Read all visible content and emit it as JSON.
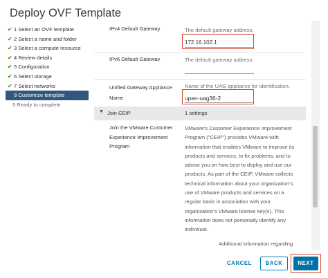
{
  "dialog": {
    "title": "Deploy OVF Template"
  },
  "steps": [
    {
      "label": "1 Select an OVF template",
      "state": "done"
    },
    {
      "label": "2 Select a name and folder",
      "state": "done"
    },
    {
      "label": "3 Select a compute resource",
      "state": "done"
    },
    {
      "label": "4 Review details",
      "state": "done"
    },
    {
      "label": "5 Configuration",
      "state": "done"
    },
    {
      "label": "6 Select storage",
      "state": "done"
    },
    {
      "label": "7 Select networks",
      "state": "done"
    },
    {
      "label": "8 Customize template",
      "state": "active"
    },
    {
      "label": "9 Ready to complete",
      "state": "pending"
    }
  ],
  "fields": {
    "ipv4": {
      "label": "IPv4 Default Gateway",
      "description": "The default gateway address.",
      "value": "172.16.102.1"
    },
    "ipv6": {
      "label": "IPv6 Default Gateway",
      "description": "The default gateway address.",
      "value": ""
    },
    "uag_name": {
      "label_line1": "Unified Gateway Appliance",
      "label_line2": "Name",
      "description": "Name of the UAG appliance for identification.",
      "value": "upen-uag36-2"
    }
  },
  "ceip_section": {
    "title": "Join CEIP",
    "count": "1 settings",
    "label_lines": [
      "Join the VMware Customer",
      "Experience Improvement",
      "Program"
    ],
    "text_lines": [
      "VMware's Customer Experience Improvement",
      "Program (\"CEIP\") provides VMware with",
      "information that enables VMware to improve its",
      "products and services, to fix problems, and to",
      "advise you on how best to deploy and use our",
      "products.  As part of the CEIP, VMware collects",
      "technical information about your organization's",
      "use of VMware products and services on a",
      "regular basis in association with your",
      "organization's VMware license key(s).  This",
      "information does not personally identify any",
      "individual."
    ],
    "more_info": "Additional information regarding"
  },
  "footer": {
    "cancel_label": "CANCEL",
    "back_label": "BACK",
    "next_label": "NEXT"
  },
  "icons": {
    "step_done": "check-icon",
    "section_toggle": "chevron-down-icon"
  },
  "colors": {
    "active_step_bg": "#31577f",
    "check_green": "#2f8400",
    "link_blue": "#0079b8",
    "primary_button": "#0072a3",
    "highlight_red": "#d9442f"
  }
}
